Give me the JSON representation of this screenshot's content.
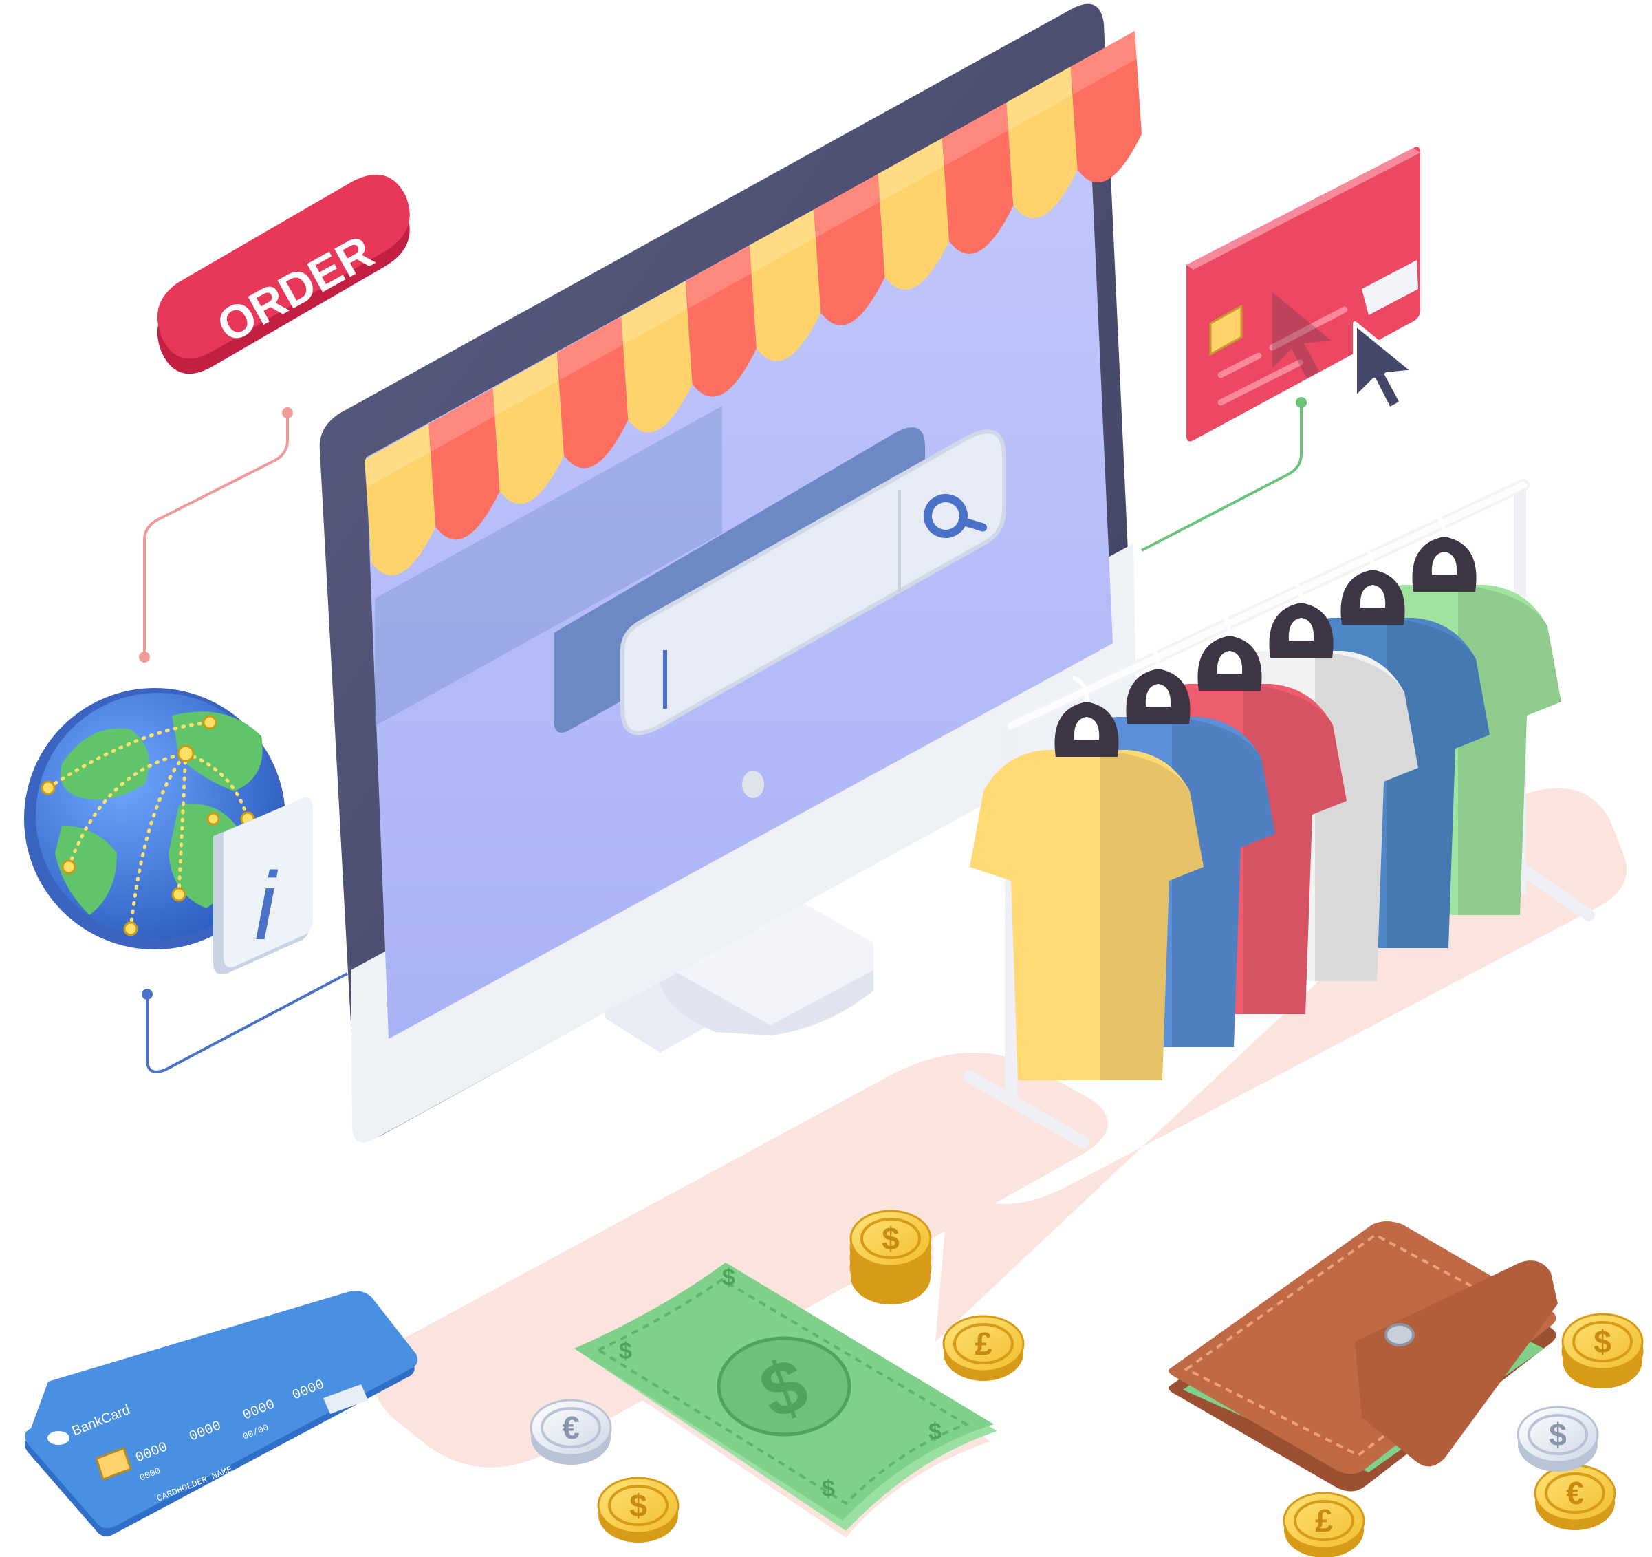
{
  "order_button": {
    "label": "ORDER",
    "color": "#e8385a"
  },
  "info_button": {
    "label": "i"
  },
  "search": {
    "value": "",
    "icon": "search-icon"
  },
  "bank_card": {
    "brand": "BankCard",
    "number_groups": [
      "0000",
      "0000",
      "0000",
      "0000"
    ],
    "small_number": "0000",
    "expiry": "00/00",
    "holder": "CARDHOLDER NAME",
    "color": "#4a90e2"
  },
  "banknote": {
    "symbol": "$",
    "corner_symbol": "$",
    "color": "#7ed08a"
  },
  "coins": [
    {
      "symbol": "$"
    },
    {
      "symbol": "£"
    },
    {
      "symbol": "€"
    },
    {
      "symbol": "$"
    },
    {
      "symbol": "$"
    },
    {
      "symbol": "€"
    },
    {
      "symbol": "$"
    },
    {
      "symbol": "£"
    }
  ],
  "colors": {
    "awning_red": "#ff6f61",
    "awning_yellow": "#ffd36b",
    "screen": "#b3bcf8",
    "monitor_frame": "#4d4f72",
    "payment_card": "#ec4763",
    "wallet": "#c06a45",
    "shirts": [
      "#ffd974",
      "#5b8fd8",
      "#ee5d6e",
      "#f2f2f2",
      "#4f86c6",
      "#9fe39e"
    ]
  }
}
